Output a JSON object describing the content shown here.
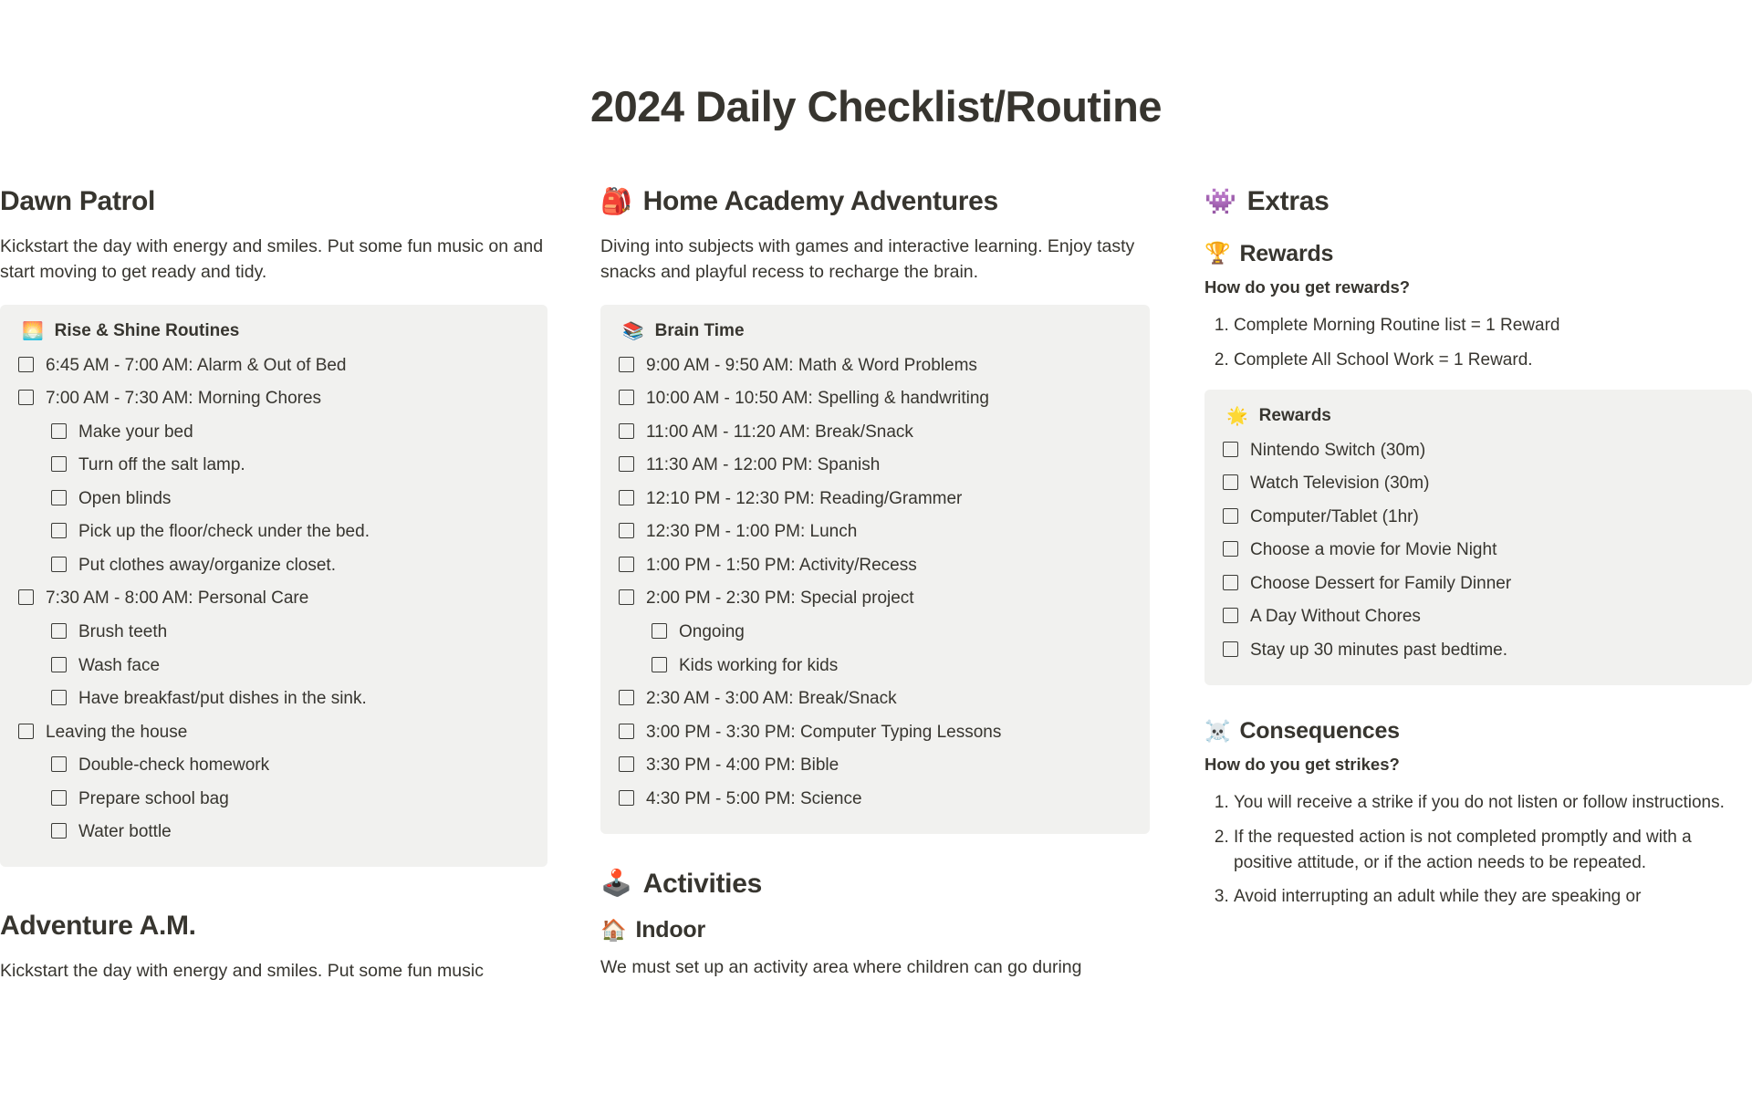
{
  "page": {
    "title": "2024 Daily Checklist/Routine"
  },
  "columns": {
    "left": {
      "dawn_patrol": {
        "heading": "Dawn Patrol",
        "description": "Kickstart the day with energy and smiles. Put some fun music on and start moving to get ready and tidy.",
        "callout": {
          "emoji": "🌅",
          "emoji_name": "sunrise-emoji",
          "title": "Rise & Shine Routines",
          "items": [
            {
              "level": 0,
              "label": "6:45 AM - 7:00 AM: Alarm & Out of Bed"
            },
            {
              "level": 0,
              "label": "7:00 AM - 7:30 AM: Morning Chores"
            },
            {
              "level": 1,
              "label": "Make your bed"
            },
            {
              "level": 1,
              "label": "Turn off the salt lamp."
            },
            {
              "level": 1,
              "label": "Open blinds"
            },
            {
              "level": 1,
              "label": "Pick up the floor/check under the bed."
            },
            {
              "level": 1,
              "label": "Put clothes away/organize closet."
            },
            {
              "level": 0,
              "label": "7:30 AM - 8:00 AM: Personal Care"
            },
            {
              "level": 1,
              "label": "Brush teeth"
            },
            {
              "level": 1,
              "label": "Wash face"
            },
            {
              "level": 1,
              "label": "Have breakfast/put dishes in the sink."
            },
            {
              "level": 0,
              "label": "Leaving the house"
            },
            {
              "level": 1,
              "label": "Double-check homework"
            },
            {
              "level": 1,
              "label": "Prepare school bag"
            },
            {
              "level": 1,
              "label": "Water bottle"
            }
          ]
        }
      },
      "adventure_am": {
        "heading": "Adventure A.M.",
        "description": "Kickstart the day with energy and smiles. Put some fun music"
      }
    },
    "middle": {
      "home_academy": {
        "emoji": "🎒",
        "emoji_name": "backpack-emoji",
        "heading": "Home Academy Adventures",
        "description": "Diving into subjects with games and interactive learning. Enjoy tasty snacks and playful recess to recharge the brain.",
        "callout": {
          "emoji": "📚",
          "emoji_name": "books-emoji",
          "title": "Brain Time",
          "items": [
            {
              "level": 0,
              "label": "9:00 AM - 9:50 AM: Math & Word Problems"
            },
            {
              "level": 0,
              "label": "10:00 AM - 10:50 AM: Spelling & handwriting"
            },
            {
              "level": 0,
              "label": "11:00 AM - 11:20 AM: Break/Snack"
            },
            {
              "level": 0,
              "label": "11:30 AM - 12:00 PM: Spanish"
            },
            {
              "level": 0,
              "label": "12:10 PM - 12:30 PM: Reading/Grammer"
            },
            {
              "level": 0,
              "label": "12:30 PM - 1:00 PM: Lunch"
            },
            {
              "level": 0,
              "label": "1:00 PM - 1:50 PM: Activity/Recess"
            },
            {
              "level": 0,
              "label": "2:00 PM - 2:30 PM: Special project"
            },
            {
              "level": 1,
              "label": "Ongoing"
            },
            {
              "level": 1,
              "label": "Kids working for kids"
            },
            {
              "level": 0,
              "label": "2:30 AM - 3:00 AM: Break/Snack"
            },
            {
              "level": 0,
              "label": "3:00 PM - 3:30 PM: Computer Typing Lessons"
            },
            {
              "level": 0,
              "label": "3:30 PM - 4:00 PM: Bible"
            },
            {
              "level": 0,
              "label": "4:30 PM - 5:00 PM: Science"
            }
          ]
        }
      },
      "activities": {
        "emoji": "🕹️",
        "emoji_name": "joystick-emoji",
        "heading": "Activities",
        "indoor": {
          "emoji": "🏠",
          "emoji_name": "house-emoji",
          "heading": "Indoor",
          "description": "We must set up an activity area where children can go during"
        }
      }
    },
    "right": {
      "extras": {
        "emoji": "👾",
        "emoji_name": "alien-monster-emoji",
        "heading": "Extras"
      },
      "rewards": {
        "emoji": "🏆",
        "emoji_name": "trophy-emoji",
        "heading": "Rewards",
        "question": "How do you get rewards?",
        "rules": [
          "Complete Morning Routine list = 1 Reward",
          "Complete All School Work = 1 Reward."
        ],
        "callout": {
          "emoji": "🌟",
          "emoji_name": "glowing-star-emoji",
          "title": "Rewards",
          "items": [
            {
              "level": 0,
              "label": "Nintendo Switch (30m)"
            },
            {
              "level": 0,
              "label": "Watch Television (30m)"
            },
            {
              "level": 0,
              "label": "Computer/Tablet (1hr)"
            },
            {
              "level": 0,
              "label": "Choose a movie for Movie Night"
            },
            {
              "level": 0,
              "label": "Choose Dessert for Family Dinner"
            },
            {
              "level": 0,
              "label": "A Day Without Chores"
            },
            {
              "level": 0,
              "label": "Stay up 30 minutes past bedtime."
            }
          ]
        }
      },
      "consequences": {
        "emoji": "☠️",
        "emoji_name": "skull-and-crossbones-emoji",
        "heading": "Consequences",
        "question": "How do you get strikes?",
        "rules": [
          "You will receive a strike if you do not listen or follow instructions.",
          "If the requested action is not completed promptly and with a positive attitude, or if the action needs to be repeated.",
          "Avoid interrupting an adult while they are speaking or"
        ]
      }
    }
  }
}
